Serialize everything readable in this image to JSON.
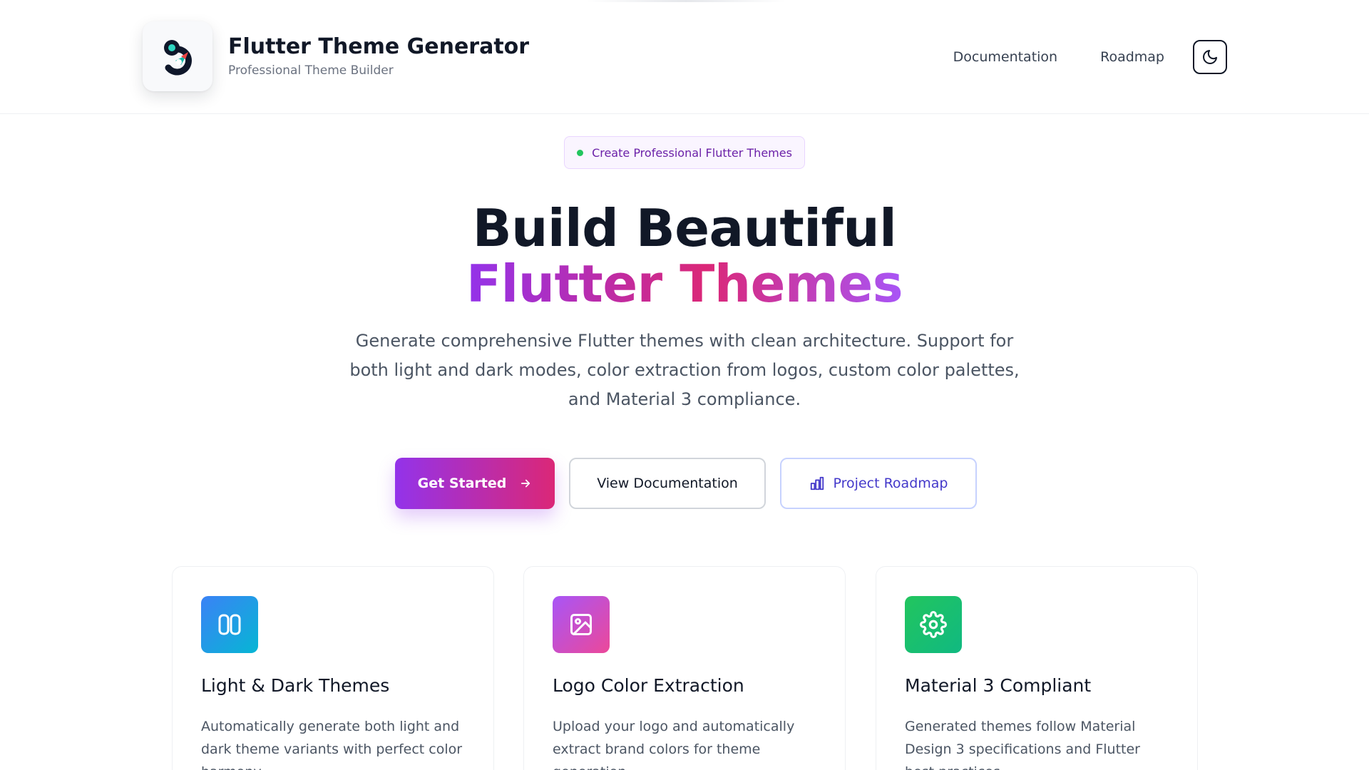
{
  "header": {
    "title": "Flutter Theme Generator",
    "subtitle": "Professional Theme Builder",
    "logo_icon": "flutter-theme-logo",
    "nav": [
      {
        "label": "Documentation"
      },
      {
        "label": "Roadmap"
      }
    ],
    "theme_toggle_icon": "moon-icon"
  },
  "hero": {
    "badge": "Create Professional Flutter Themes",
    "title_line1": "Build Beautiful",
    "title_line2": "Flutter Themes",
    "description": "Generate comprehensive Flutter themes with clean architecture. Support for both light and dark modes, color extraction from logos, custom color palettes, and Material 3 compliance.",
    "buttons": {
      "get_started": "Get Started",
      "view_docs": "View Documentation",
      "roadmap": "Project Roadmap"
    }
  },
  "features": [
    {
      "icon": "columns-icon",
      "title": "Light & Dark Themes",
      "description": "Automatically generate both light and dark theme variants with perfect color harmony."
    },
    {
      "icon": "image-icon",
      "title": "Logo Color Extraction",
      "description": "Upload your logo and automatically extract brand colors for theme generation."
    },
    {
      "icon": "gear-icon",
      "title": "Material 3 Compliant",
      "description": "Generated themes follow Material Design 3 specifications and Flutter best practices."
    }
  ],
  "colors": {
    "primary_purple": "#9333ea",
    "primary_pink": "#db2777",
    "roadmap_indigo": "#4338ca",
    "badge_dot_green": "#22c55e"
  }
}
